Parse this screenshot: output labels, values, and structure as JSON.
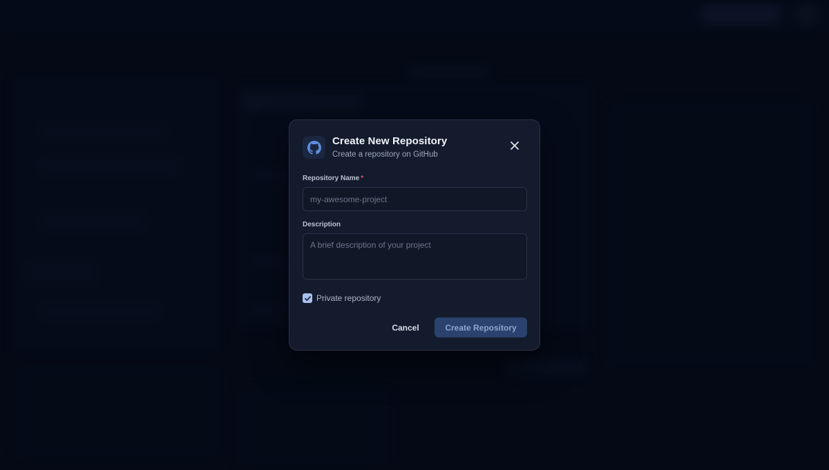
{
  "modal": {
    "title": "Create New Repository",
    "subtitle": "Create a repository on GitHub",
    "icon": "github-icon",
    "close_icon": "close-icon"
  },
  "form": {
    "name_label": "Repository Name",
    "name_required_mark": "*",
    "name_value": "",
    "name_placeholder": "my-awesome-project",
    "description_label": "Description",
    "description_value": "",
    "description_placeholder": "A brief description of your project",
    "private_label": "Private repository",
    "private_checked": true
  },
  "actions": {
    "cancel_label": "Cancel",
    "create_label": "Create Repository"
  },
  "colors": {
    "backdrop": "#060b18",
    "modal_bg": "#131b2c",
    "accent": "#2a426d",
    "checkbox": "#a8c1f0",
    "required": "#e0566a"
  }
}
